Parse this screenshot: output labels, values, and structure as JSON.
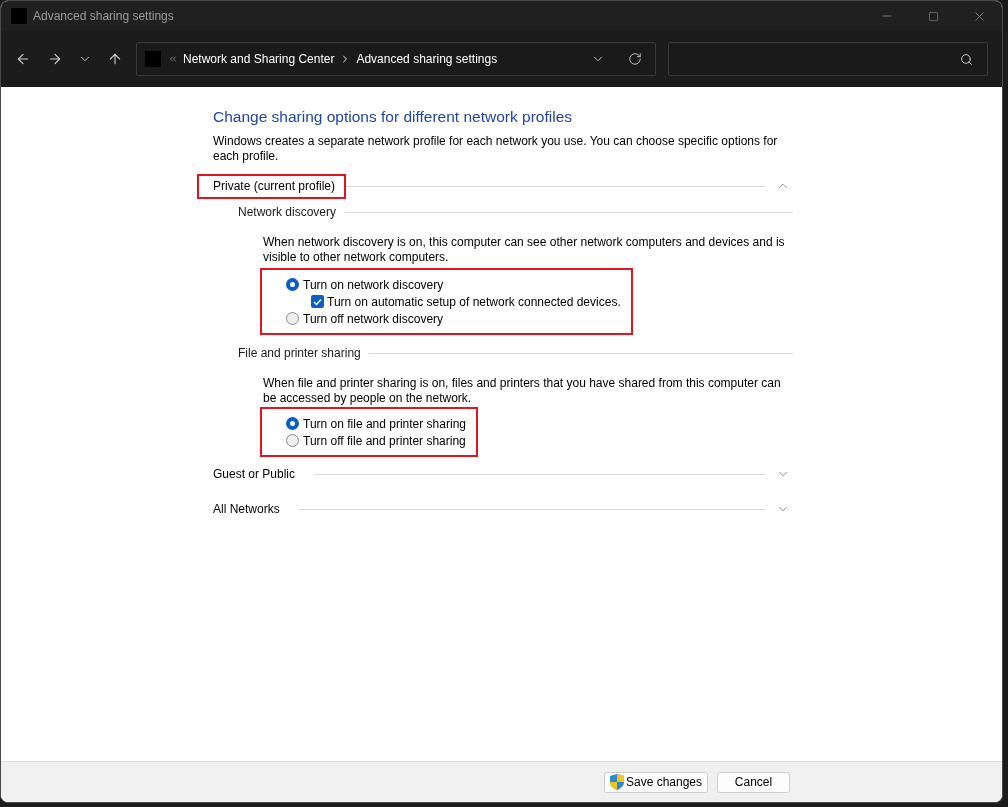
{
  "window": {
    "title": "Advanced sharing settings"
  },
  "address_bar": {
    "breadcrumbs": [
      "Network and Sharing Center",
      "Advanced sharing settings"
    ]
  },
  "page": {
    "heading": "Change sharing options for different network profiles",
    "description": "Windows creates a separate network profile for each network you use. You can choose specific options for each profile."
  },
  "profiles": [
    {
      "title": "Private (current profile)",
      "expanded": true,
      "highlighted": true,
      "sections": [
        {
          "title": "Network discovery",
          "description": "When network discovery is on, this computer can see other network computers and devices and is visible to other network computers.",
          "options_highlighted": true,
          "options": [
            {
              "kind": "radio",
              "label": "Turn on network discovery",
              "selected": true,
              "children": [
                {
                  "kind": "checkbox",
                  "label": "Turn on automatic setup of network connected devices.",
                  "checked": true
                }
              ]
            },
            {
              "kind": "radio",
              "label": "Turn off network discovery",
              "selected": false
            }
          ]
        },
        {
          "title": "File and printer sharing",
          "description": "When file and printer sharing is on, files and printers that you have shared from this computer can be accessed by people on the network.",
          "options_highlighted": true,
          "options": [
            {
              "kind": "radio",
              "label": "Turn on file and printer sharing",
              "selected": true
            },
            {
              "kind": "radio",
              "label": "Turn off file and printer sharing",
              "selected": false
            }
          ]
        }
      ]
    },
    {
      "title": "Guest or Public",
      "expanded": false,
      "highlighted": false
    },
    {
      "title": "All Networks",
      "expanded": false,
      "highlighted": false
    }
  ],
  "buttons": [
    {
      "label": "Save changes",
      "elevated": true
    },
    {
      "label": "Cancel",
      "elevated": false
    }
  ]
}
